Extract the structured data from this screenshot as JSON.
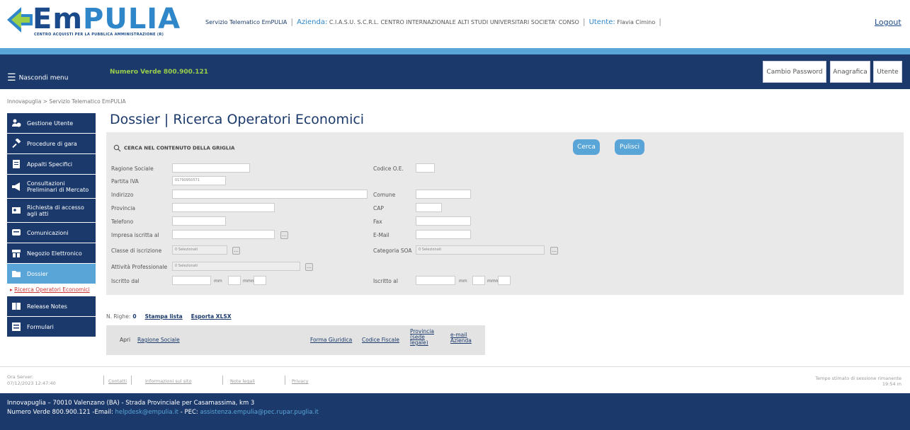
{
  "header": {
    "logo_text": "EmPULIA",
    "logo_subtitle": "CENTRO ACQUISTI PER LA PUBBLICA AMMINISTRAZIONE (R)",
    "service": "Servizio Telematico EmPULIA",
    "azienda_label": "Azienda:",
    "azienda_value": "C.I.A.S.U. S.C.R.L. CENTRO INTERNAZIONALE ALTI STUDI UNIVERSITARI SOCIETA' CONSO",
    "utente_label": "Utente:",
    "utente_value": "Flavia Cimino",
    "logout": "Logout"
  },
  "nav": {
    "menu_toggle": "Nascondi menu",
    "numero_verde": "Numero Verde 800.900.121",
    "buttons": [
      "Cambio Password",
      "Anagrafica",
      "Utente"
    ]
  },
  "breadcrumb": "Innovapuglia > Servizio Telematico EmPULIA",
  "sidebar": {
    "items": [
      {
        "label": "Gestione Utente",
        "icon": "users-icon"
      },
      {
        "label": "Procedure di gara",
        "icon": "gavel-icon"
      },
      {
        "label": "Appalti Specifici",
        "icon": "document-icon"
      },
      {
        "label": "Consultazioni Preliminari di Mercato",
        "icon": "megaphone-icon"
      },
      {
        "label": "Richiesta di accesso agli atti",
        "icon": "access-request-icon"
      },
      {
        "label": "Comunicazioni",
        "icon": "chat-icon"
      },
      {
        "label": "Negozio Elettronico",
        "icon": "store-icon"
      },
      {
        "label": "Dossier",
        "icon": "folder-icon"
      },
      {
        "label": "Release Notes",
        "icon": "book-icon"
      },
      {
        "label": "Formulari",
        "icon": "form-icon"
      }
    ],
    "sub_item": "Ricerca Operatori Economici"
  },
  "page": {
    "title": "Dossier | Ricerca Operatori Economici"
  },
  "search": {
    "header": "CERCA NEL CONTENUTO DELLA GRIGLIA",
    "cerca": "Cerca",
    "pulisci": "Pulisci",
    "left_labels": [
      "Ragione Sociale",
      "Partita IVA",
      "Indirizzo",
      "Provincia",
      "Telefono",
      "Impresa iscritta al",
      "Classe di iscrizione",
      "Attività Professionale",
      "Iscritto dal"
    ],
    "right_labels": [
      "Codice O.E.",
      "Comune",
      "CAP",
      "Fax",
      "E-Mail",
      "Categoria SOA",
      "Iscritto al"
    ],
    "partita_iva_value": "01790950571",
    "placeholder_select": "0 Selezionati",
    "mm": "mm",
    "mmm": "mmm"
  },
  "table": {
    "n_righe_label": "N. Righe:",
    "n_righe_value": "0",
    "stampa": "Stampa lista",
    "esporta": "Esporta XLSX",
    "columns": [
      "Apri",
      "Ragione Sociale",
      "Forma Giuridica",
      "Codice Fiscale",
      "Provincia (sede legale)",
      "e-mail Azienda"
    ]
  },
  "footer": {
    "ora_server_label": "Ora Server:",
    "ora_server_value": "07/12/2023 12:47:40",
    "links": [
      "Contatti",
      "Informazioni sul sito",
      "Note legali",
      "Privacy"
    ],
    "session_label": "Tempo stimato di sessione rimanente",
    "session_value": "19:54 m",
    "address": "Innovapuglia – 70010 Valenzano (BA) - Strada Provinciale per Casamassima, km 3",
    "numero_verde": "Numero Verde 800.900.121",
    "email_label": "-Email:",
    "email": "helpdesk@empulia.it",
    "pec_label": "- PEC:",
    "pec": "assistenza.empulia@pec.rupar.puglia.it"
  }
}
